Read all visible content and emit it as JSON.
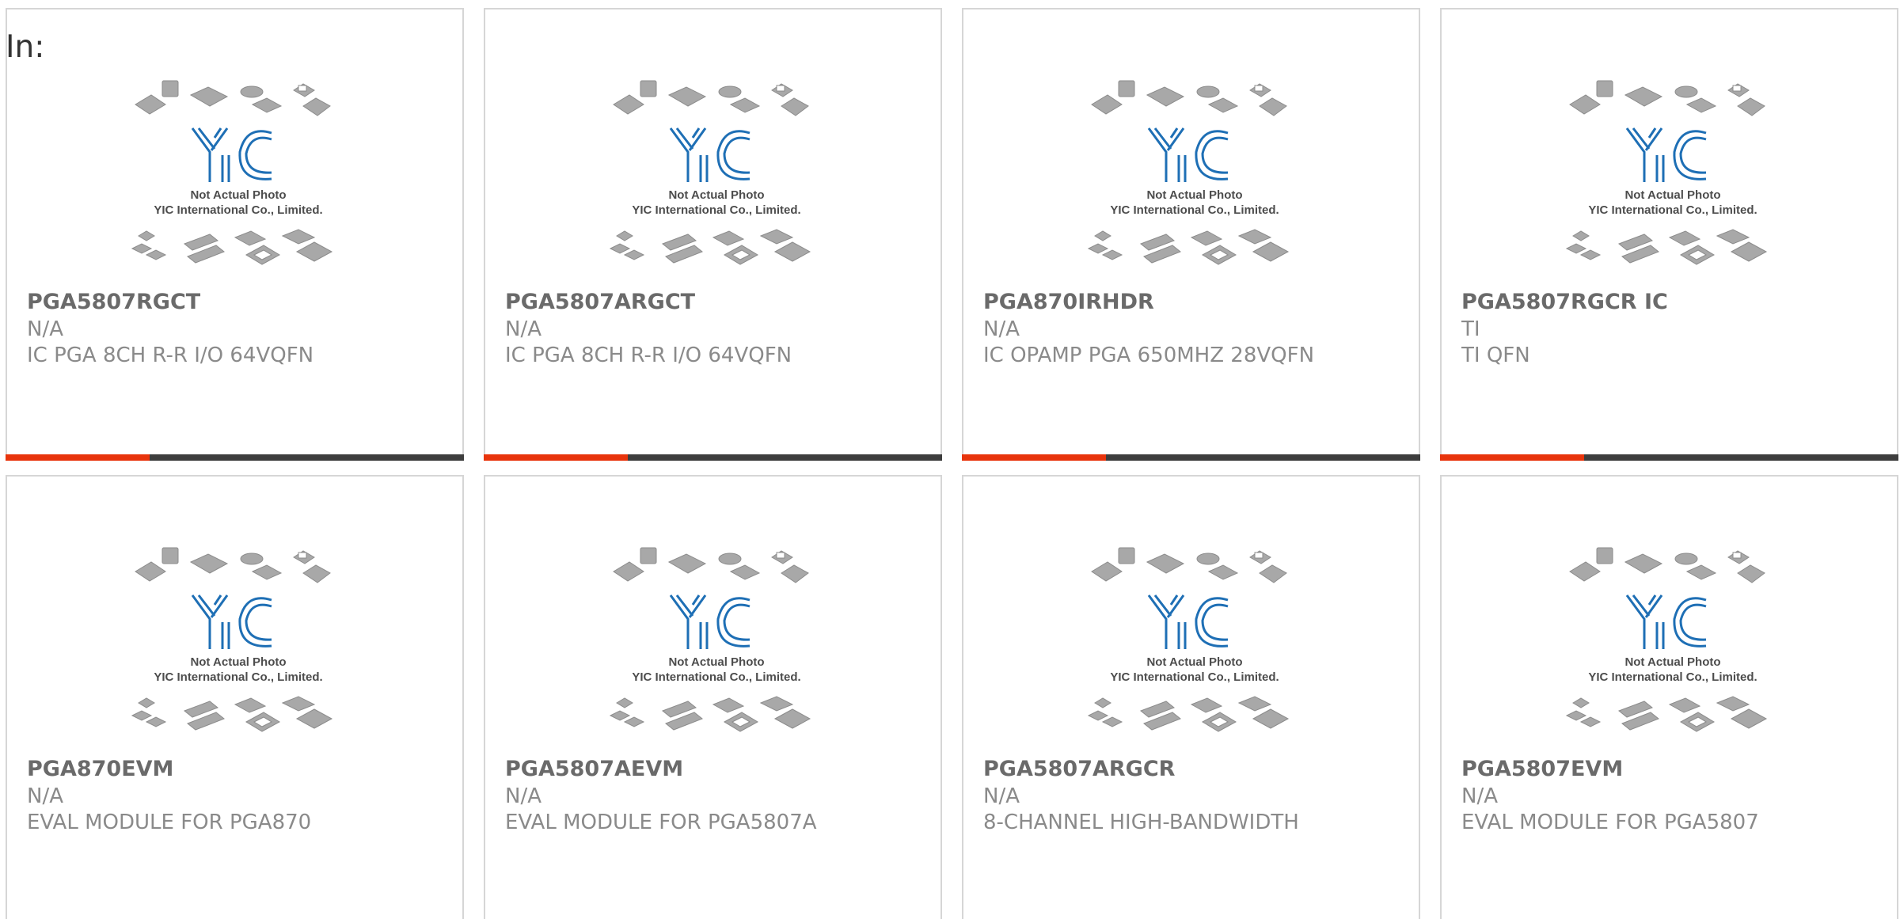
{
  "header": {
    "label": "In:"
  },
  "photo": {
    "logo_text": "YIC",
    "caption_line1": "Not Actual Photo",
    "caption_line2": "YIC International Co., Limited.",
    "logo_color": "#1e6fb5"
  },
  "colors": {
    "accent": "#e8340c",
    "bar": "#3d3d3d",
    "border": "#d6d6d6"
  },
  "products": [
    {
      "part": "PGA5807RGCT",
      "mfr": "N/A",
      "desc": "IC PGA 8CH R-R I/O 64VQFN"
    },
    {
      "part": "PGA5807ARGCT",
      "mfr": "N/A",
      "desc": "IC PGA 8CH R-R I/O 64VQFN"
    },
    {
      "part": "PGA870IRHDR",
      "mfr": "N/A",
      "desc": "IC OPAMP PGA 650MHZ 28VQFN"
    },
    {
      "part": "PGA5807RGCR IC",
      "mfr": "TI",
      "desc": "TI QFN"
    },
    {
      "part": "PGA870EVM",
      "mfr": "N/A",
      "desc": "EVAL MODULE FOR PGA870"
    },
    {
      "part": "PGA5807AEVM",
      "mfr": "N/A",
      "desc": "EVAL MODULE FOR PGA5807A"
    },
    {
      "part": "PGA5807ARGCR",
      "mfr": "N/A",
      "desc": "8-CHANNEL HIGH-BANDWIDTH"
    },
    {
      "part": "PGA5807EVM",
      "mfr": "N/A",
      "desc": "EVAL MODULE FOR PGA5807"
    }
  ]
}
